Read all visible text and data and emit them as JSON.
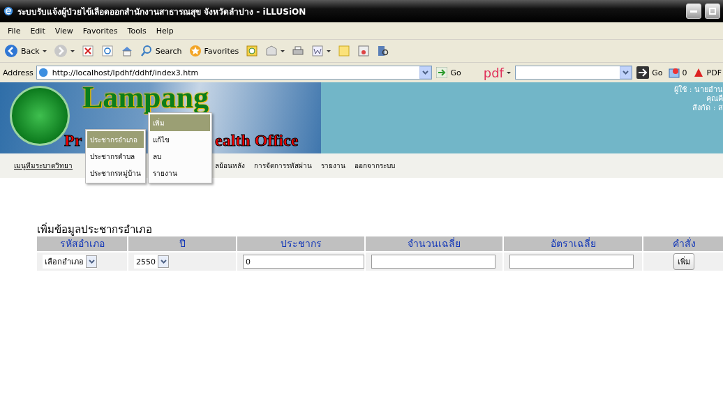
{
  "window": {
    "title": "ระบบรับแจ้งผู้ป่วยไข้เลือดออกสำนักงานสาธารณสุข จังหวัดลำปาง - iLLUSiON"
  },
  "menu_bar": [
    "File",
    "Edit",
    "View",
    "Favorites",
    "Tools",
    "Help"
  ],
  "toolbar": {
    "back": "Back",
    "search": "Search",
    "favorites": "Favorites"
  },
  "address_bar": {
    "label": "Address",
    "url": "http://localhost/lpdhf/ddhf/index3.htm",
    "go": "Go"
  },
  "pdf_bar": {
    "logo": "pdf",
    "go": "Go",
    "count": "0",
    "pdf": "PDF"
  },
  "banner": {
    "title": "Lampang",
    "subtitle_left": "Pr",
    "subtitle_right": "ealth Office",
    "user_info": [
      "ผู้ใช้ : นายอำน",
      "คุณคื",
      "สังกัด : ส"
    ]
  },
  "nav": [
    {
      "label": "เมนูทีมระบาดวิทยา",
      "selected": true
    },
    {
      "label": "ลย้อนหลัง",
      "selected": false
    },
    {
      "label": "การจัดการรหัสผ่าน",
      "selected": false
    },
    {
      "label": "รายงาน",
      "selected": false
    },
    {
      "label": "ออกจากระบบ",
      "selected": false
    }
  ],
  "dropdown": {
    "items": [
      {
        "label": "ประชากรอำเภอ",
        "selected": true
      },
      {
        "label": "ประชากรตำบล",
        "selected": false
      },
      {
        "label": "ประชากรหมู่บ้าน",
        "selected": false
      }
    ],
    "submenu": [
      {
        "label": "เพิ่ม",
        "selected": true
      },
      {
        "label": "แก้ไข",
        "selected": false
      },
      {
        "label": "ลบ",
        "selected": false
      },
      {
        "label": "รายงาน",
        "selected": false
      }
    ]
  },
  "form": {
    "title": "เพิ่มข้อมูลประชากรอำเภอ",
    "columns": [
      "รหัสอำเภอ",
      "ปี",
      "ประชากร",
      "จำนวนเฉลี่ย",
      "อัตราเฉลี่ย",
      "คำสั่ง"
    ],
    "row": [
      {
        "kind": "select",
        "value": "เลือกอำเภอ"
      },
      {
        "kind": "select",
        "value": "2550"
      },
      {
        "kind": "input",
        "value": "0"
      },
      {
        "kind": "input"
      },
      {
        "kind": "input"
      },
      {
        "kind": "button",
        "value": "เพิ่ม"
      }
    ]
  }
}
